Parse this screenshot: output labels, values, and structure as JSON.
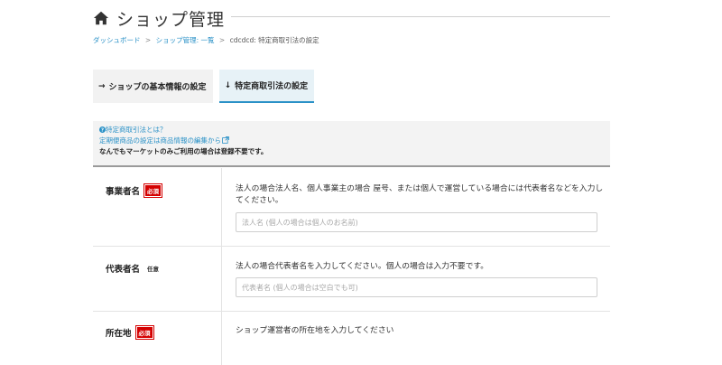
{
  "header": {
    "title": "ショップ管理",
    "icon": "home-icon"
  },
  "breadcrumb": {
    "items": [
      "ダッシュボード",
      "ショップ管理: 一覧",
      "cdcdcd: 特定商取引法の設定"
    ],
    "separator": ">"
  },
  "tabs": [
    {
      "label": "ショップの基本情報の設定",
      "arrow": "→"
    },
    {
      "label": "特定商取引法の設定",
      "arrow": "↓"
    }
  ],
  "info": {
    "what_is_link": "特定商取引法とは？",
    "subscription_link": "定期便商品の設定は商品情報の編集から",
    "note": "なんでもマーケットのみご利用の場合は登録不要です。"
  },
  "fields": {
    "business_name": {
      "label": "事業者名",
      "badge": "必須",
      "description": "法人の場合法人名、個人事業主の場合 屋号、または個人で運営している場合には代表者名などを入力してください。",
      "placeholder": "法人名 (個人の場合は個人のお名前)",
      "value": ""
    },
    "representative": {
      "label": "代表者名",
      "badge": "任意",
      "description": "法人の場合代表者名を入力してください。個人の場合は入力不要です。",
      "placeholder": "代表者名 (個人の場合は空白でも可)",
      "value": ""
    },
    "address": {
      "label": "所在地",
      "badge": "必須",
      "description": "ショップ運営者の所在地を入力してください"
    }
  },
  "colors": {
    "accent": "#2a91c7",
    "required_badge": "#d40000"
  }
}
